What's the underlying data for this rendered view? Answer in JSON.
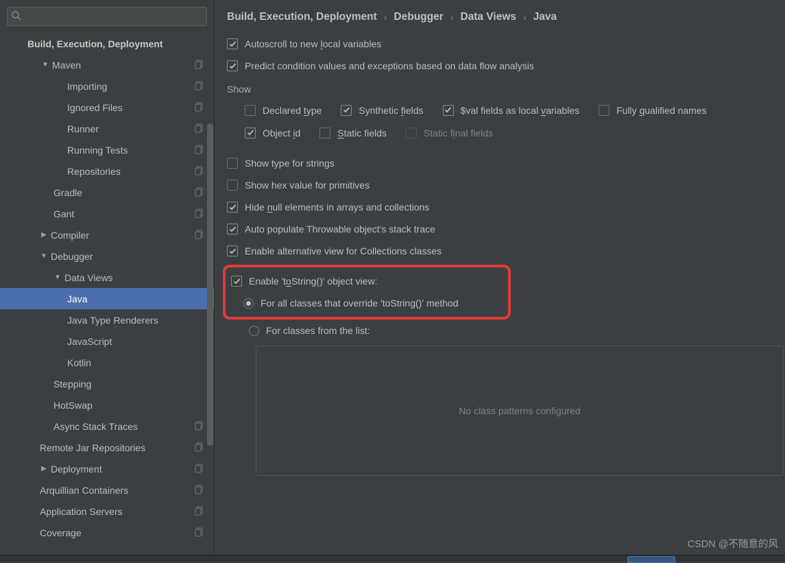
{
  "search": {
    "placeholder": ""
  },
  "sidebar": {
    "header": "Build, Execution, Deployment",
    "items": [
      {
        "label": "Maven",
        "indent": 60,
        "arrow": "down",
        "copy": true
      },
      {
        "label": "Importing",
        "indent": 98,
        "copy": true
      },
      {
        "label": "Ignored Files",
        "indent": 98,
        "copy": true
      },
      {
        "label": "Runner",
        "indent": 98,
        "copy": true
      },
      {
        "label": "Running Tests",
        "indent": 98,
        "copy": true
      },
      {
        "label": "Repositories",
        "indent": 98,
        "copy": true
      },
      {
        "label": "Gradle",
        "indent": 78,
        "copy": true
      },
      {
        "label": "Gant",
        "indent": 78,
        "copy": true
      },
      {
        "label": "Compiler",
        "indent": 58,
        "arrow": "right",
        "copy": true
      },
      {
        "label": "Debugger",
        "indent": 58,
        "arrow": "down"
      },
      {
        "label": "Data Views",
        "indent": 78,
        "arrow": "down"
      },
      {
        "label": "Java",
        "indent": 98,
        "selected": true
      },
      {
        "label": "Java Type Renderers",
        "indent": 98
      },
      {
        "label": "JavaScript",
        "indent": 98
      },
      {
        "label": "Kotlin",
        "indent": 98
      },
      {
        "label": "Stepping",
        "indent": 78
      },
      {
        "label": "HotSwap",
        "indent": 78
      },
      {
        "label": "Async Stack Traces",
        "indent": 78,
        "copy": true
      },
      {
        "label": "Remote Jar Repositories",
        "indent": 58,
        "copy": true
      },
      {
        "label": "Deployment",
        "indent": 58,
        "arrow": "right",
        "copy": true
      },
      {
        "label": "Arquillian Containers",
        "indent": 58,
        "copy": true
      },
      {
        "label": "Application Servers",
        "indent": 58,
        "copy": true
      },
      {
        "label": "Coverage",
        "indent": 58,
        "copy": true
      }
    ]
  },
  "breadcrumb": [
    "Build, Execution, Deployment",
    "Debugger",
    "Data Views",
    "Java"
  ],
  "top_checks": [
    {
      "label_pre": "Autoscroll to new ",
      "u": "l",
      "label_post": "ocal variables",
      "checked": true
    },
    {
      "label_pre": "Predict condition values and exceptions based on data flow analysis",
      "checked": true
    }
  ],
  "show_label": "Show",
  "show_grid": {
    "r1": [
      {
        "pre": "Declared ",
        "u": "t",
        "post": "ype",
        "checked": false
      },
      {
        "pre": "Synthetic ",
        "u": "f",
        "post": "ields",
        "checked": true
      },
      {
        "pre": "$val fields as local ",
        "u": "v",
        "post": "ariables",
        "checked": true
      },
      {
        "pre": "Fully ",
        "u": "q",
        "post": "ualified names",
        "checked": false
      }
    ],
    "r2": [
      {
        "pre": "Object ",
        "u": "i",
        "post": "d",
        "checked": true
      },
      {
        "u": "S",
        "post": "tatic fields",
        "checked": false
      },
      {
        "pre": "Static f",
        "u": "i",
        "post": "nal fields",
        "checked": false,
        "disabled": true
      }
    ]
  },
  "misc": [
    {
      "label": "Show type for strings",
      "checked": false
    },
    {
      "label": "Show hex value for primitives",
      "checked": false
    },
    {
      "pre": "Hide ",
      "u": "n",
      "post": "ull elements in arrays and collections",
      "checked": true
    },
    {
      "label": "Auto populate Throwable object's stack trace",
      "checked": true
    },
    {
      "label": "Enable alternative view for Collections classes",
      "checked": true
    }
  ],
  "tostring": {
    "enable_pre": "Enable 't",
    "enable_u": "o",
    "enable_post": "String()' object view:",
    "opt1": "For all classes that override 'toString()' method",
    "opt2": "For classes from the list:"
  },
  "listarea_text": "No class patterns configured",
  "watermark": "CSDN @不随意的风"
}
